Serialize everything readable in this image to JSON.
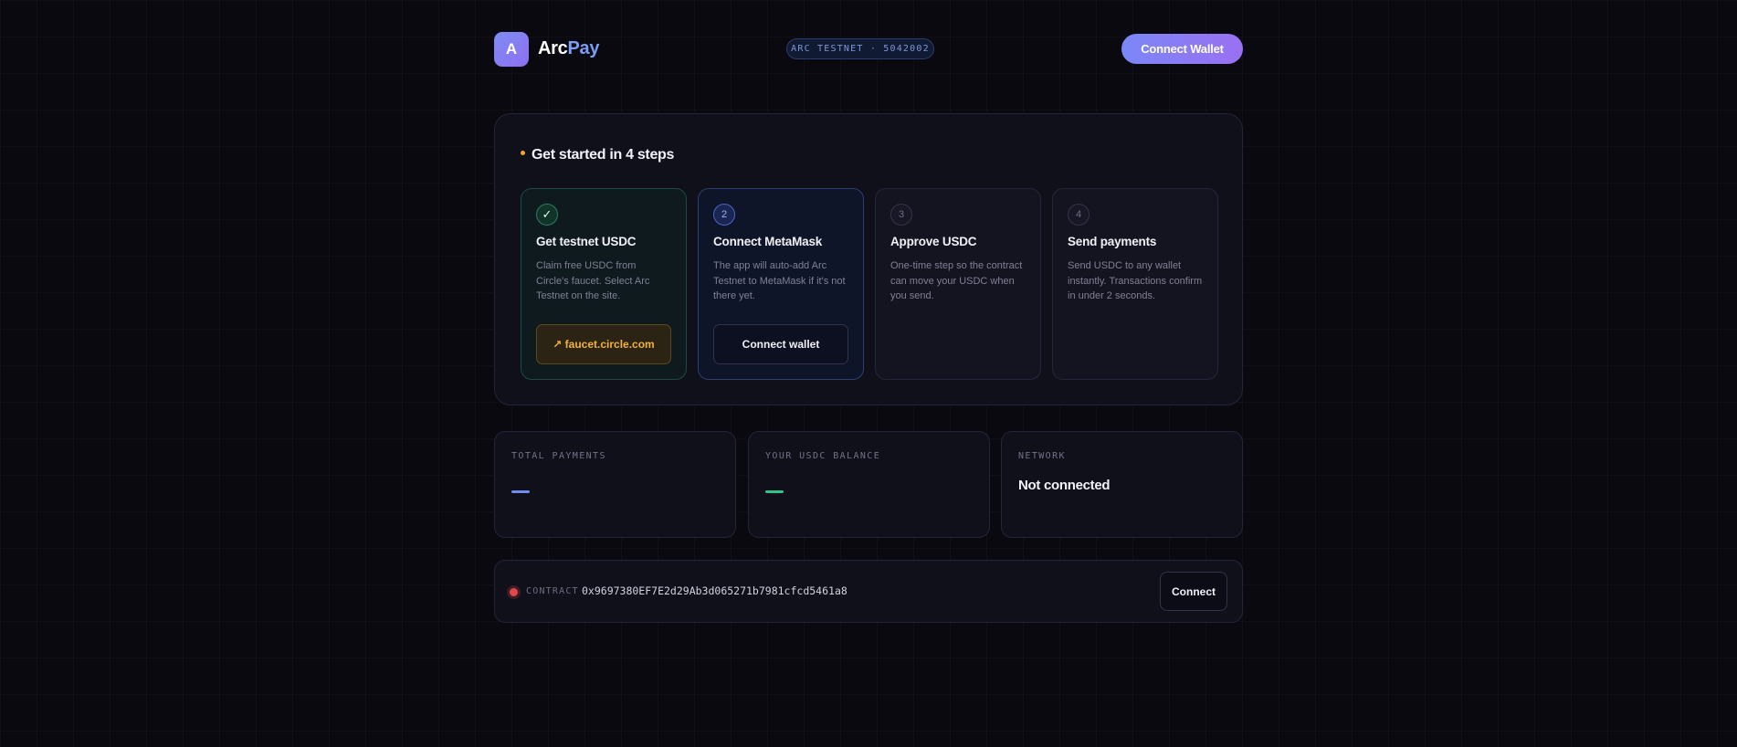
{
  "header": {
    "logo_letter": "A",
    "brand_part1": "Arc",
    "brand_part2": "Pay",
    "network_badge": "ARC TESTNET · 5042002",
    "connect_wallet_label": "Connect Wallet"
  },
  "steps": {
    "title": "Get started in 4 steps",
    "items": [
      {
        "marker": "✓",
        "title": "Get testnet USDC",
        "description": "Claim free USDC from Circle's faucet. Select Arc Testnet on the site.",
        "action_label": "↗ faucet.circle.com",
        "status": "done"
      },
      {
        "marker": "2",
        "title": "Connect MetaMask",
        "description": "The app will auto-add Arc Testnet to MetaMask if it's not there yet.",
        "action_label": "Connect wallet",
        "status": "active"
      },
      {
        "marker": "3",
        "title": "Approve USDC",
        "description": "One-time step so the contract can move your USDC when you send.",
        "status": "pending"
      },
      {
        "marker": "4",
        "title": "Send payments",
        "description": "Send USDC to any wallet instantly. Transactions confirm in under 2 seconds.",
        "status": "pending"
      }
    ]
  },
  "stats": {
    "total_payments": {
      "label": "TOTAL PAYMENTS",
      "value": "—"
    },
    "usdc_balance": {
      "label": "YOUR USDC BALANCE",
      "value": "—"
    },
    "network": {
      "label": "NETWORK",
      "value": "Not connected"
    }
  },
  "contract": {
    "label": "CONTRACT",
    "address": "0x9697380EF7E2d29Ab3d065271b7981cfcd5461a8",
    "status": "disconnected",
    "connect_label": "Connect"
  },
  "colors": {
    "background": "#09090f",
    "accent_blue": "#7c9cf5",
    "accent_purple": "#9a70f1",
    "faucet_gold": "#f2b13a",
    "success_green": "#31c48d",
    "status_red": "#e04848"
  }
}
